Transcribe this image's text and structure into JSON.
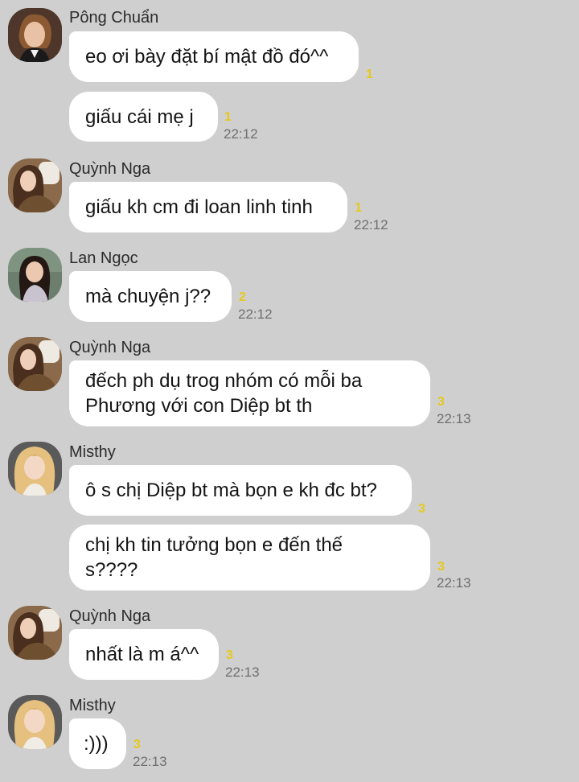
{
  "colors": {
    "background": "#cfcfcf",
    "bubble": "#ffffff",
    "unread_count": "#e6c91d",
    "timestamp": "#6f6f6f"
  },
  "messages": [
    {
      "sender": "Pông Chuẩn",
      "avatar_icon": "user-avatar-icon",
      "text": "eo ơi bày đặt bí mật đồ đó^^",
      "count": "1",
      "time": ""
    },
    {
      "sender": "",
      "text": "giấu cái mẹ j",
      "count": "1",
      "time": "22:12"
    },
    {
      "sender": "Quỳnh Nga",
      "avatar_icon": "user-avatar-icon",
      "text": "giấu kh cm đi loan linh tinh",
      "count": "1",
      "time": "22:12"
    },
    {
      "sender": "Lan Ngọc",
      "avatar_icon": "user-avatar-icon",
      "text": "mà chuyện j??",
      "count": "2",
      "time": "22:12"
    },
    {
      "sender": "Quỳnh Nga",
      "avatar_icon": "user-avatar-icon",
      "text": "đếch ph dụ trog nhóm có mỗi ba\nPhương với con Diệp bt th",
      "count": "3",
      "time": "22:13"
    },
    {
      "sender": "Misthy",
      "avatar_icon": "user-avatar-icon",
      "text": "ô s chị Diệp bt mà bọn e kh đc bt?",
      "count": "3",
      "time": ""
    },
    {
      "sender": "",
      "text": "chị kh tin tưởng bọn e đến thế\ns????",
      "count": "3",
      "time": "22:13"
    },
    {
      "sender": "Quỳnh Nga",
      "avatar_icon": "user-avatar-icon",
      "text": "nhất là m á^^",
      "count": "3",
      "time": "22:13"
    },
    {
      "sender": "Misthy",
      "avatar_icon": "user-avatar-icon",
      "text": ":)))",
      "count": "3",
      "time": "22:13"
    }
  ]
}
